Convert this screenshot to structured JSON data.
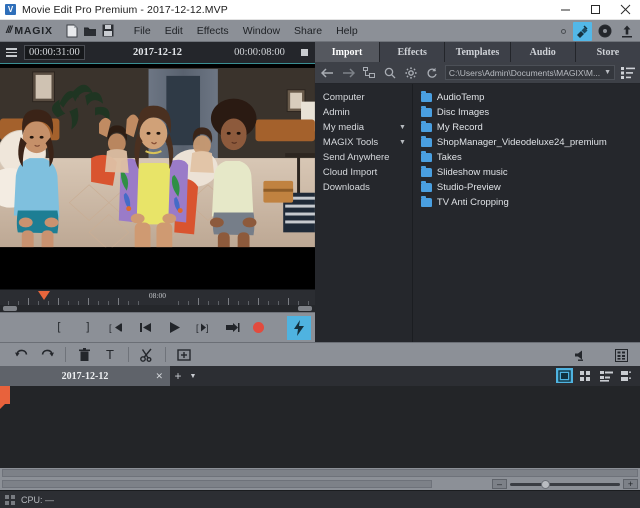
{
  "window": {
    "title": "Movie Edit Pro Premium - 2017-12-12.MVP",
    "app_icon": "magix-logo-icon",
    "minimize": "–",
    "maximize": "□",
    "close": "✕"
  },
  "menubar": {
    "brand_slashes": "///",
    "brand": "MAGIX",
    "icons": [
      {
        "name": "new-project-icon",
        "glyph": "🗋"
      },
      {
        "name": "open-project-icon",
        "glyph": "📁"
      },
      {
        "name": "save-project-icon",
        "glyph": "💾"
      }
    ],
    "items": [
      "File",
      "Edit",
      "Effects",
      "Window",
      "Share",
      "Help"
    ],
    "right_icons": [
      {
        "name": "finish-movie-icon",
        "active": true
      },
      {
        "name": "burn-disc-icon",
        "active": false
      },
      {
        "name": "export-upload-icon",
        "active": false
      }
    ]
  },
  "monitor": {
    "menu_icon": "hamburger-menu-icon",
    "timecode_position": "00:00:31:00",
    "title": "2017-12-12",
    "timecode_duration": "00:00:08:00",
    "ruler_label": "08:00",
    "transport": [
      {
        "name": "set-in-point-button",
        "label": "["
      },
      {
        "name": "set-out-point-button",
        "label": "]"
      },
      {
        "name": "jump-to-start-button",
        "label": "[←"
      },
      {
        "name": "previous-frame-button",
        "label": "⏮"
      },
      {
        "name": "play-button",
        "label": "▶"
      },
      {
        "name": "next-frame-button",
        "label": "[▶]"
      },
      {
        "name": "jump-to-end-button",
        "label": "→]"
      },
      {
        "name": "record-button",
        "label": ""
      }
    ],
    "quick_button": "flash-quick-export-button"
  },
  "media_pool": {
    "tabs": [
      {
        "label": "Import",
        "active": true
      },
      {
        "label": "Effects",
        "active": false
      },
      {
        "label": "Templates",
        "active": false
      },
      {
        "label": "Audio",
        "active": false
      },
      {
        "label": "Store",
        "active": false
      }
    ],
    "toolbar": [
      {
        "name": "back-icon",
        "glyph": "←"
      },
      {
        "name": "forward-icon",
        "glyph": "→"
      },
      {
        "name": "folder-tree-icon",
        "glyph": "⎇"
      },
      {
        "name": "search-icon",
        "glyph": "⚲"
      },
      {
        "name": "settings-gear-icon",
        "glyph": "⚙"
      },
      {
        "name": "refresh-icon",
        "glyph": "↻"
      }
    ],
    "path_value": "C:\\Users\\Admin\\Documents\\MAGIX\\M...",
    "view-options-icon": "list-view-icon",
    "tree": [
      {
        "label": "Computer",
        "expandable": false
      },
      {
        "label": "Admin",
        "expandable": false
      },
      {
        "label": "My media",
        "expandable": true
      },
      {
        "label": "MAGIX Tools",
        "expandable": true
      },
      {
        "label": "Send Anywhere",
        "expandable": false
      },
      {
        "label": "Cloud Import",
        "expandable": false
      },
      {
        "label": "Downloads",
        "expandable": false
      }
    ],
    "files": [
      "AudioTemp",
      "Disc Images",
      "My Record",
      "ShopManager_Videodeluxe24_premium",
      "Takes",
      "Slideshow music",
      "Studio-Preview",
      "TV Anti Cropping"
    ]
  },
  "edit_toolbar": {
    "buttons": [
      {
        "name": "undo-button",
        "glyph": "↶"
      },
      {
        "name": "redo-button",
        "glyph": "↷"
      },
      {
        "name": "delete-button",
        "glyph": "🗑"
      },
      {
        "name": "title-text-button",
        "glyph": "T"
      },
      {
        "name": "cut-scissors-button",
        "glyph": "✂"
      },
      {
        "name": "add-media-button",
        "glyph": "⊞"
      }
    ],
    "right_buttons": [
      {
        "name": "audio-mixer-icon",
        "glyph": "🔊"
      },
      {
        "name": "track-manager-icon",
        "glyph": "⊟"
      }
    ]
  },
  "project_tabs": {
    "tabs": [
      {
        "label": "2017-12-12",
        "close": "✕",
        "active": true
      }
    ],
    "add_label": "+",
    "dropdown_label": "▼",
    "view_modes": [
      {
        "name": "storyboard-view-button",
        "active": true
      },
      {
        "name": "scene-overview-button",
        "active": false
      },
      {
        "name": "timeline-view-button",
        "active": false
      },
      {
        "name": "multicam-view-button",
        "active": false
      }
    ]
  },
  "bottom": {
    "zoom_out_label": "–",
    "zoom_in_label": "+",
    "zoom_value": 28
  },
  "statusbar": {
    "cpu_label": "CPU: —"
  },
  "colors": {
    "accent_blue": "#4fb3e0",
    "accent_orange": "#e8623c",
    "record_red": "#e24b3e",
    "chrome_gray": "#8c9097",
    "panel_dark": "#25272c"
  }
}
